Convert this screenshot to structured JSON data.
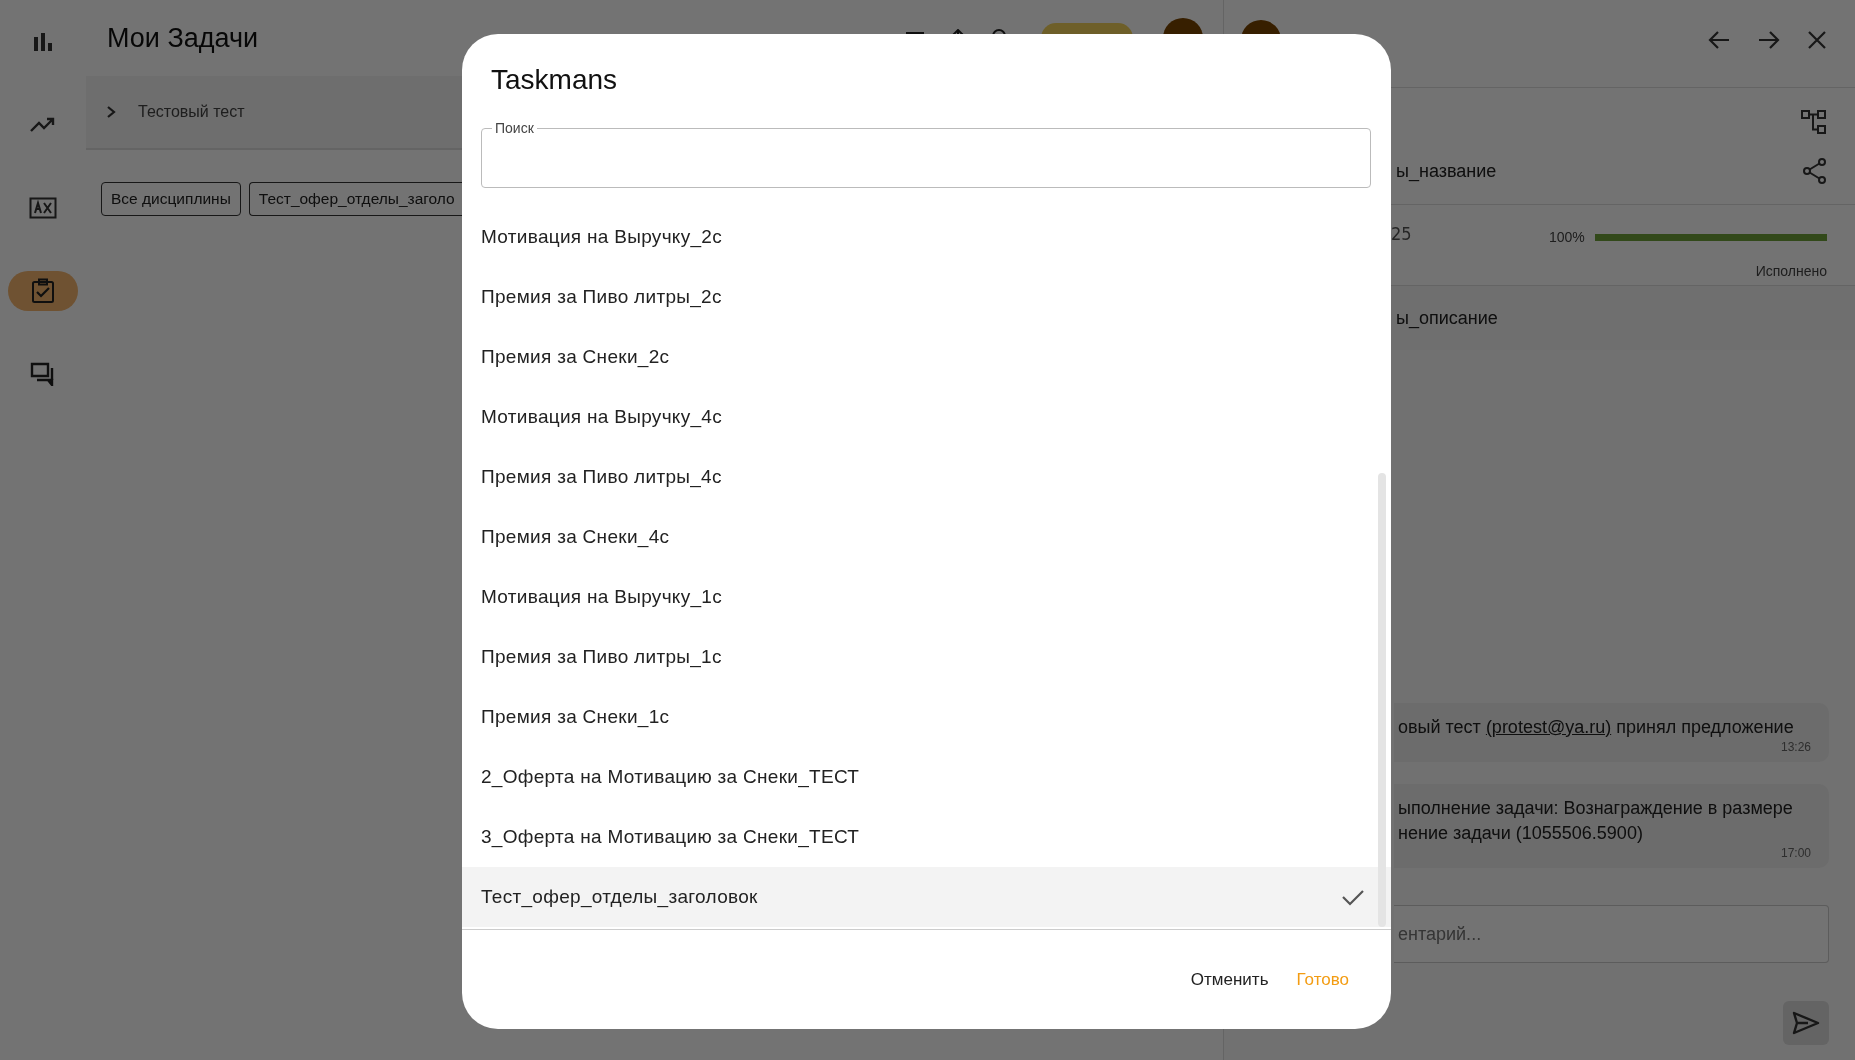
{
  "sidebar": {
    "items": [
      {
        "kind": "bar-chart",
        "selected": false
      },
      {
        "kind": "trend",
        "selected": false
      },
      {
        "kind": "ax",
        "selected": false
      },
      {
        "kind": "tasks",
        "selected": true
      },
      {
        "kind": "chat",
        "selected": false
      }
    ]
  },
  "main": {
    "title": "Мои Задачи",
    "group": {
      "label": "Тестовый тест",
      "expanded": false
    },
    "filters": [
      "Все дисциплины",
      "Тест_офер_отделы_заголо"
    ]
  },
  "panel": {
    "name": "ы_название",
    "date": "25",
    "progress": {
      "reading": "100%",
      "level": 1,
      "status": "Исполнено"
    },
    "description": "ы_описание",
    "messages": [
      {
        "before": "овый тест",
        "link": "(protest@ya.ru)",
        "after": "принял предложение",
        "time": "13:26"
      },
      {
        "lines": [
          "ыполнение задачи: Вознаграждение в размере",
          "нение задачи (1055506.5900)"
        ],
        "time": "17:00"
      }
    ],
    "comment": {
      "placeholder": "ентарий..."
    }
  },
  "dialog": {
    "title": "Taskmans",
    "search": {
      "label": "Поиск"
    },
    "items": [
      {
        "label": "Мотивация на Выручку_2с",
        "selected": false
      },
      {
        "label": "Премия за Пиво литры_2с",
        "selected": false
      },
      {
        "label": "Премия за Снеки_2с",
        "selected": false
      },
      {
        "label": "Мотивация на Выручку_4с",
        "selected": false
      },
      {
        "label": "Премия за Пиво литры_4с",
        "selected": false
      },
      {
        "label": "Премия за Снеки_4с",
        "selected": false
      },
      {
        "label": "Мотивация на Выручку_1с",
        "selected": false
      },
      {
        "label": "Премия за Пиво литры_1с",
        "selected": false
      },
      {
        "label": "Премия за Снеки_1с",
        "selected": false
      },
      {
        "label": "2_Оферта на Мотивацию за Снеки_ТЕСТ",
        "selected": false
      },
      {
        "label": "3_Оферта на Мотивацию за Снеки_ТЕСТ",
        "selected": false
      },
      {
        "label": "Тест_офер_отделы_заголовок",
        "selected": true
      }
    ],
    "buttons": [
      {
        "label": "Отменить",
        "kind": "cancel"
      },
      {
        "label": "Готово",
        "kind": "confirm"
      }
    ]
  }
}
